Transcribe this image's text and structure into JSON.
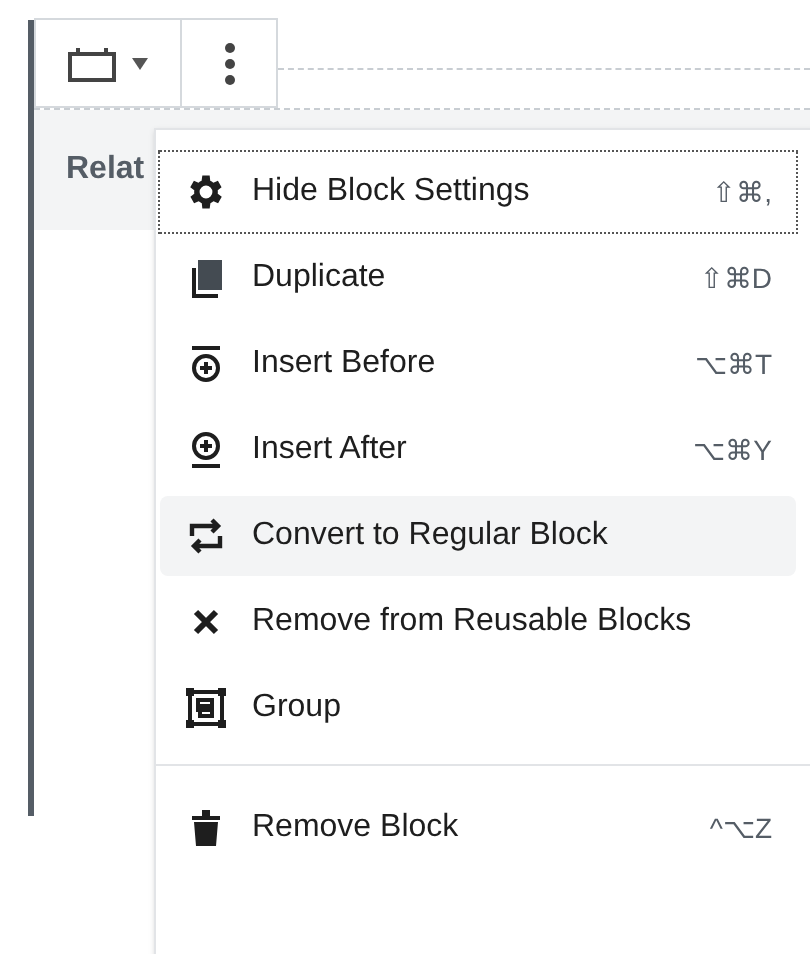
{
  "toolbar": {
    "block_button": {
      "expanded": false
    },
    "more_button": {
      "expanded": true
    }
  },
  "content": {
    "text": "Relat"
  },
  "menu": {
    "sections": [
      {
        "items": [
          {
            "label": "Hide Block Settings",
            "shortcut": "⇧⌘,",
            "focused": true,
            "highlighted": false
          },
          {
            "label": "Duplicate",
            "shortcut": "⇧⌘D",
            "focused": false,
            "highlighted": false
          },
          {
            "label": "Insert Before",
            "shortcut": "⌥⌘T",
            "focused": false,
            "highlighted": false
          },
          {
            "label": "Insert After",
            "shortcut": "⌥⌘Y",
            "focused": false,
            "highlighted": false
          },
          {
            "label": "Convert to Regular Block",
            "focused": false,
            "highlighted": true
          },
          {
            "label": "Remove from Reusable Blocks",
            "focused": false,
            "highlighted": false
          },
          {
            "label": "Group",
            "focused": false,
            "highlighted": false
          }
        ]
      },
      {
        "items": [
          {
            "label": "Remove Block",
            "shortcut": "^⌥Z",
            "focused": false,
            "highlighted": false
          }
        ]
      }
    ]
  }
}
